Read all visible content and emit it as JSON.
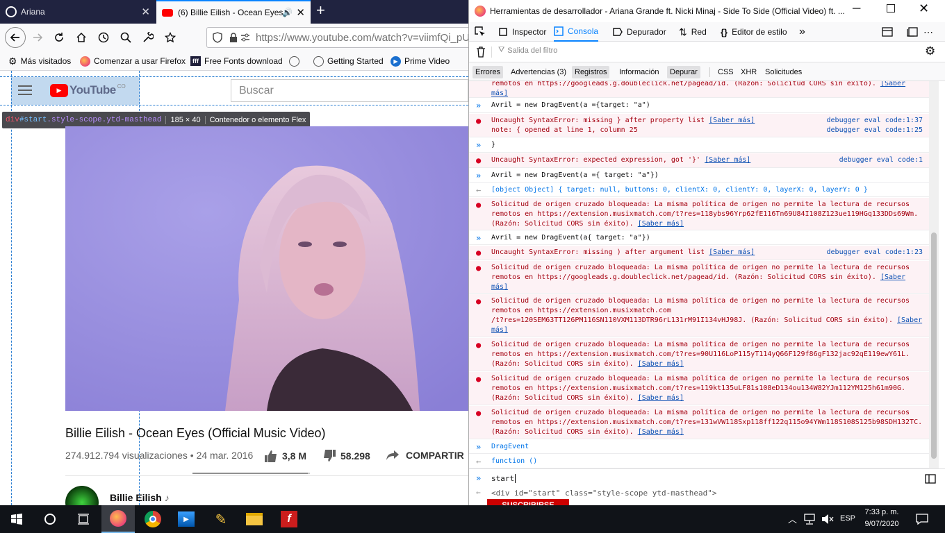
{
  "tabs": [
    {
      "title": "Ariana",
      "close": "✕"
    },
    {
      "title": "(6) Billie Eilish - Ocean Eyes",
      "close": "✕"
    }
  ],
  "new_tab": "+",
  "url": "https://www.youtube.com/watch?v=viimfQi_pUw",
  "bookmarks": [
    "Más visitados",
    "Comenzar a usar Firefox",
    "Free Fonts download",
    "Getting Started",
    "Prime Video"
  ],
  "youtube": {
    "logo": "YouTube",
    "logo_sup": "CO",
    "search_placeholder": "Buscar",
    "inspector_tip": {
      "sel_tag": "div",
      "sel_id": "#start",
      "sel_class": ".style-scope.ytd-masthead",
      "size": "185 × 40",
      "label": "Contenedor o elemento Flex"
    },
    "video_title": "Billie Eilish - Ocean Eyes (Official Music Video)",
    "views_date": "274.912.794 visualizaciones • 24 mar. 2016",
    "likes": "3,8 M",
    "dislikes": "58.298",
    "share": "COMPARTIR",
    "channel": "Billie Eilish",
    "subscribe": "SUSCRIBIRSE",
    "like_ratio": 0.985
  },
  "devtools": {
    "window_title": "Herramientas de desarrollador - Ariana Grande ft. Nicki Minaj - Side To Side (Official Video) ft. ...",
    "tools": [
      "Inspector",
      "Consola",
      "Depurador",
      "Red",
      "Editor de estilo"
    ],
    "active_tool": "Consola",
    "filter_placeholder": "Salida del filtro",
    "categories": [
      "Errores",
      "Advertencias (3)",
      "Registros",
      "Información",
      "Depurar",
      "CSS",
      "XHR",
      "Solicitudes"
    ],
    "command_input": "start",
    "command_result": "<div id=\"start\" class=\"style-scope ytd-masthead\">",
    "log_lines": [
      "remotos en https://googleads.g.doubleclick.net/pagead/id. (Razón: Solicitud CORS sin éxito).",
      "más]",
      "Avril = new DragEvent(a ={target: \"a\")",
      "Uncaught SyntaxError: missing } after property list",
      "note: { opened at line 1, column 25",
      "}",
      "Uncaught SyntaxError: expected expression, got '}'",
      "Avril = new DragEvent(a ={ target: \"a\"})",
      "[object Object] { target: null, buttons: 0, clientX: 0, clientY: 0, layerX: 0, layerY: 0 }",
      "Solicitud de origen cruzado bloqueada: La misma política de origen no permite la lectura de recursos",
      "remotos en https://extension.musixmatch.com/t?res=118ybs96Yrp62fE116Tn69U84I108Z123ue119HGq133DDs69Wm.",
      "(Razón: Solicitud CORS sin éxito).",
      "Avril = new DragEvent(a{ target: \"a\"})",
      "Uncaught SyntaxError: missing ) after argument list",
      "Solicitud de origen cruzado bloqueada: La misma política de origen no permite la lectura de recursos",
      "remotos en https://googleads.g.doubleclick.net/pagead/id. (Razón: Solicitud CORS sin éxito).",
      "más]",
      "Solicitud de origen cruzado bloqueada: La misma política de origen no permite la lectura de recursos",
      "remotos en https://extension.musixmatch.com",
      "/t?res=120SEM63TT126PM116SN110VXM113DTR96rL131rM91I134vHJ98J. (Razón: Solicitud CORS sin éxito).",
      "más]",
      "Solicitud de origen cruzado bloqueada: La misma política de origen no permite la lectura de recursos",
      "remotos en https://extension.musixmatch.com/t?res=90U116LoP115yT114yQ66F129f86gF132jac92qE119ewY61L.",
      "(Razón: Solicitud CORS sin éxito).",
      "Solicitud de origen cruzado bloqueada: La misma política de origen no permite la lectura de recursos",
      "remotos en https://extension.musixmatch.com/t?res=119kt135uLF81s108eD134ou134W82YJm112YM125h61m90G.",
      "(Razón: Solicitud CORS sin éxito).",
      "Solicitud de origen cruzado bloqueada: La misma política de origen no permite la lectura de recursos",
      "remotos en https://extension.musixmatch.com/t?res=131wVW118Sxp118ff122q115o94YWm118S108S125b98SDH132TC.",
      "(Razón: Solicitud CORS sin éxito).",
      "DragEvent",
      "function ()"
    ],
    "learn_more": "[Saber más]",
    "learn_more_open": "[Saber",
    "sources": [
      "debugger eval code:1:37",
      "debugger eval code:1:25",
      "debugger eval code:1",
      "debugger eval code:1:23"
    ]
  },
  "taskbar": {
    "language": "ESP",
    "time": "7:33 p. m.",
    "date": "9/07/2020"
  }
}
